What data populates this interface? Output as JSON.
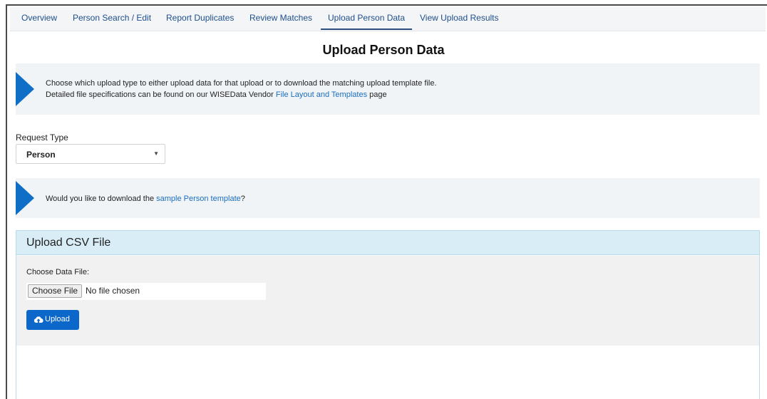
{
  "tabs": [
    {
      "label": "Overview"
    },
    {
      "label": "Person Search / Edit"
    },
    {
      "label": "Report Duplicates"
    },
    {
      "label": "Review Matches"
    },
    {
      "label": "Upload Person Data"
    },
    {
      "label": "View Upload Results"
    }
  ],
  "active_tab": "Upload Person Data",
  "page_title": "Upload Person Data",
  "info1": {
    "line1": "Choose which upload type to either upload data for that upload or to download the matching upload template file.",
    "line2_prefix": "Detailed file specifications can be found on our WISEData Vendor ",
    "line2_link": "File Layout and Templates",
    "line2_suffix": " page"
  },
  "request_type": {
    "label": "Request Type",
    "value": "Person"
  },
  "info2": {
    "prefix": "Would you like to download the ",
    "link": "sample Person template",
    "suffix": "?"
  },
  "upload_panel": {
    "title": "Upload CSV File",
    "choose_label": "Choose Data File:",
    "file_button": "Choose File",
    "file_status": "No file chosen",
    "upload_button": "Upload"
  },
  "colors": {
    "accent": "#0f6fc6",
    "link": "#1a6ec0",
    "panel_header": "#d9edf7",
    "upload_button": "#0b67c9"
  },
  "icons": [
    "triangle-pointer-icon",
    "cloud-upload-icon",
    "caret-down-icon"
  ]
}
